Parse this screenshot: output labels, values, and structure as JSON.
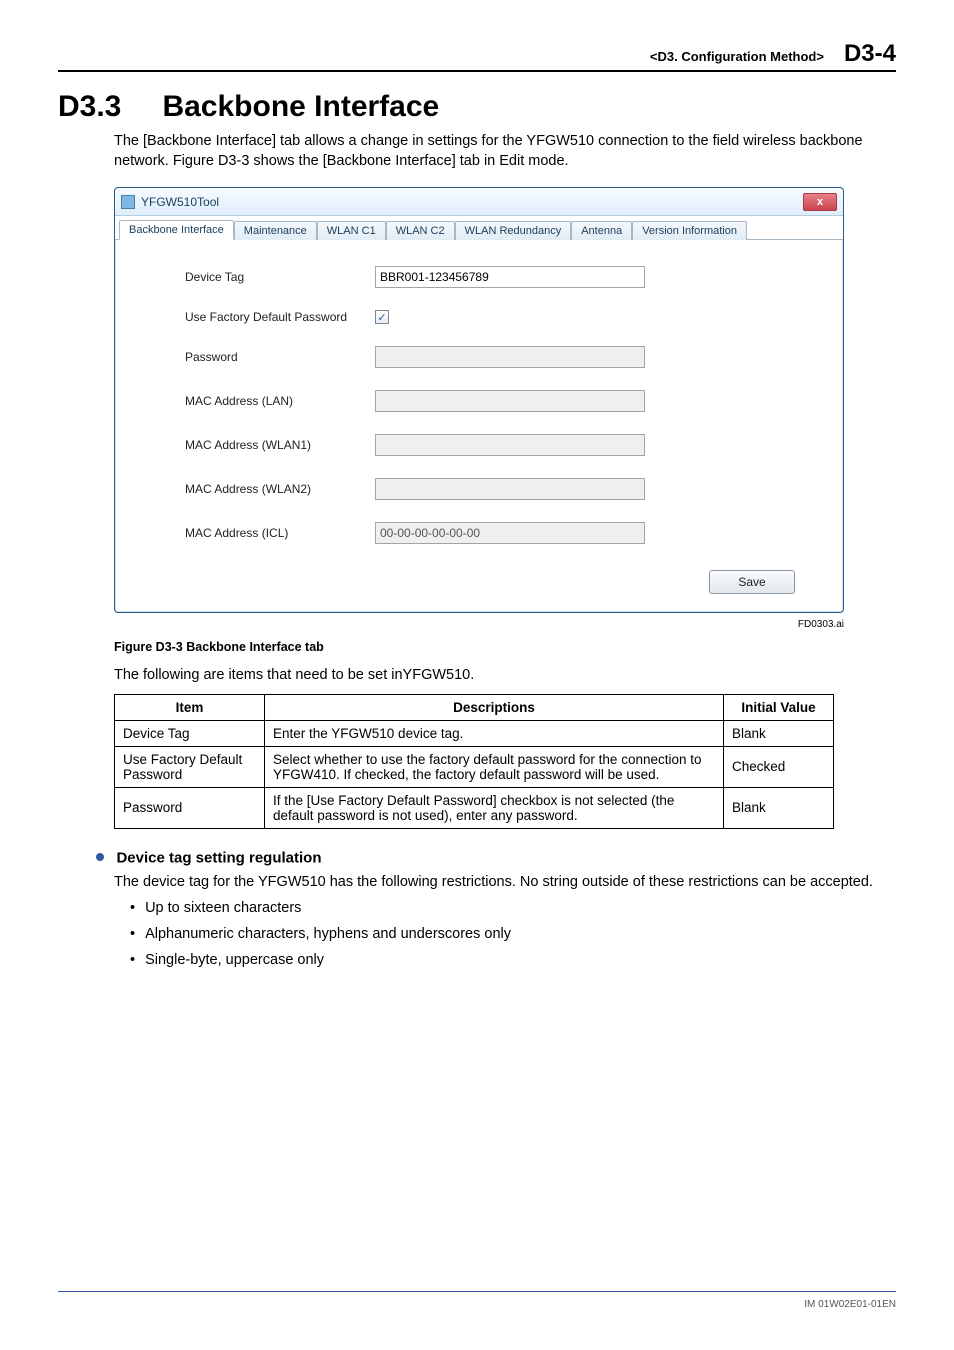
{
  "header": {
    "section": "<D3.  Configuration Method>",
    "page": "D3-4"
  },
  "title": {
    "num": "D3.3",
    "text": "Backbone Interface"
  },
  "intro": "The [Backbone Interface] tab allows a change in settings for the YFGW510 connection to the field wireless backbone network. Figure D3-3 shows the [Backbone Interface] tab in Edit mode.",
  "window": {
    "title": "YFGW510Tool",
    "close": "x",
    "tabs": [
      "Backbone Interface",
      "Maintenance",
      "WLAN C1",
      "WLAN C2",
      "WLAN Redundancy",
      "Antenna",
      "Version Information"
    ],
    "fields": {
      "device_tag_label": "Device Tag",
      "device_tag_value": "BBR001-123456789",
      "use_default_label": "Use Factory Default Password",
      "checkmark": "✓",
      "password_label": "Password",
      "password_value": "",
      "mac_lan_label": "MAC Address (LAN)",
      "mac_lan_value": "",
      "mac_w1_label": "MAC Address (WLAN1)",
      "mac_w1_value": "",
      "mac_w2_label": "MAC Address (WLAN2)",
      "mac_w2_value": "",
      "mac_icl_label": "MAC Address (ICL)",
      "mac_icl_value": "00-00-00-00-00-00",
      "save": "Save"
    }
  },
  "figure_id": "FD0303.ai",
  "figure_caption": "Figure D3-3    Backbone Interface tab",
  "lead_text": "The following are items that need to be set inYFGW510.",
  "table": {
    "headers": [
      "Item",
      "Descriptions",
      "Initial Value"
    ],
    "rows": [
      {
        "item": "Device Tag",
        "desc": "Enter the YFGW510 device tag.",
        "val": "Blank"
      },
      {
        "item": "Use Factory Default Password",
        "desc": "Select whether to use the factory default password for the connection to YFGW410. If checked, the factory default password will be used.",
        "val": "Checked"
      },
      {
        "item": "Password",
        "desc": "If the [Use Factory Default Password] checkbox is not selected (the default password is not used), enter any password.",
        "val": "Blank"
      }
    ]
  },
  "subheading": "Device tag setting regulation",
  "sub_body": "The device tag for the YFGW510 has the following restrictions. No string outside of these restrictions can be accepted.",
  "rules": [
    "Up to sixteen characters",
    "Alphanumeric characters, hyphens and underscores only",
    "Single-byte, uppercase only"
  ],
  "footer": "IM 01W02E01-01EN"
}
